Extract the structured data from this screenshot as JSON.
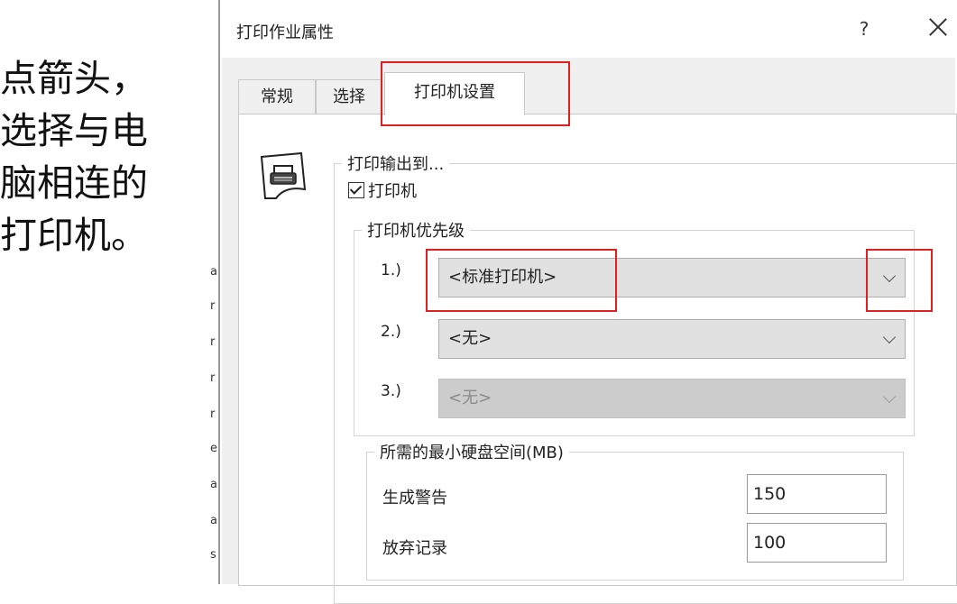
{
  "annotation": {
    "text": "点箭头，\n选择与电\n脑相连的\n打印机。"
  },
  "left_edge_glyphs": [
    "a",
    "r",
    "r",
    "r",
    "r",
    "e",
    "a",
    "a",
    "s"
  ],
  "dialog": {
    "title": "打印作业属性",
    "help_label": "?",
    "tabs": [
      {
        "label": "常规",
        "active": false
      },
      {
        "label": "选择",
        "active": false
      },
      {
        "label": "打印机设置",
        "active": true
      }
    ],
    "output_group": {
      "legend": "打印输出到...",
      "printer_checkbox": {
        "label": "打印机",
        "checked": true
      }
    },
    "priority_group": {
      "legend": "打印机优先级",
      "items": [
        {
          "label": "1.)",
          "value": "<标准打印机>",
          "enabled": true
        },
        {
          "label": "2.)",
          "value": "<无>",
          "enabled": true
        },
        {
          "label": "3.)",
          "value": "<无>",
          "enabled": false
        }
      ]
    },
    "disk_group": {
      "legend": "所需的最小硬盘空间(MB)",
      "warning": {
        "label": "生成警告",
        "value": "150"
      },
      "abandon": {
        "label": "放弃记录",
        "value": "100"
      }
    }
  },
  "colors": {
    "highlight": "#e02020",
    "select_bg": "#e1e1e1",
    "disabled_bg": "#cccccc"
  },
  "icons": [
    "printer-icon",
    "chevron-down-icon",
    "close-icon",
    "help-icon",
    "checkmark-icon"
  ]
}
